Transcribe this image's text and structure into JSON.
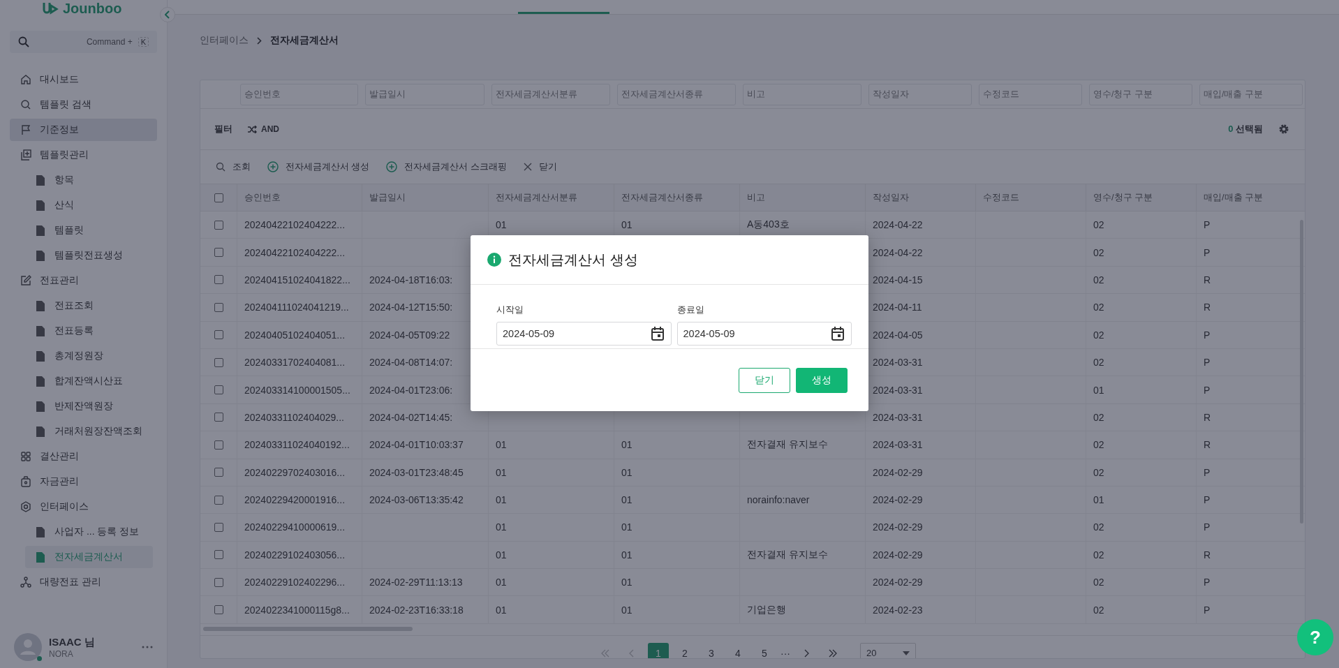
{
  "logo": "Jounboo",
  "sidebar": {
    "search": {
      "placeholder": "Command +",
      "shortcut": "K"
    },
    "items": [
      {
        "label": "대시보드",
        "highlighted": false,
        "selected": false
      },
      {
        "label": "템플릿 검색",
        "highlighted": false,
        "selected": false
      },
      {
        "label": "기준정보",
        "highlighted": true,
        "selected": false
      },
      {
        "label": "템플릿관리",
        "highlighted": false,
        "selected": false,
        "children": [
          {
            "label": "항목",
            "selected": false
          },
          {
            "label": "산식",
            "selected": false
          },
          {
            "label": "템플릿",
            "selected": false
          },
          {
            "label": "템플릿전표생성",
            "selected": false
          }
        ]
      },
      {
        "label": "전표관리",
        "highlighted": false,
        "selected": false,
        "children": [
          {
            "label": "전표조회",
            "selected": false
          },
          {
            "label": "전표등록",
            "selected": false
          },
          {
            "label": "총계정원장",
            "selected": false
          },
          {
            "label": "합계잔액시산표",
            "selected": false
          },
          {
            "label": "반제잔액원장",
            "selected": false
          },
          {
            "label": "거래처원장잔액조회",
            "selected": false
          }
        ]
      },
      {
        "label": "결산관리",
        "highlighted": false,
        "selected": false
      },
      {
        "label": "자금관리",
        "highlighted": false,
        "selected": false
      },
      {
        "label": "인터페이스",
        "highlighted": false,
        "selected": false,
        "children": [
          {
            "label": "사업자 ...   등록 정보",
            "selected": false
          },
          {
            "label": "전자세금계산서",
            "selected": true
          }
        ]
      },
      {
        "label": "대량전표 관리",
        "highlighted": false,
        "selected": false
      }
    ],
    "user": {
      "name": "ISAAC 님",
      "org": "NORA",
      "online": true
    }
  },
  "breadcrumb": [
    "인터페이스",
    "전자세금계산서"
  ],
  "filter_fields": [
    "승인번호",
    "발급일시",
    "전자세금계산서분류",
    "전자세금계산서종류",
    "비고",
    "작성일자",
    "수정코드",
    "영수/청구 구분",
    "매입/매출 구분"
  ],
  "filter_bar": {
    "label": "필터",
    "mode": "AND",
    "selected_count": "0",
    "selected_label": "선택됨"
  },
  "toolbar": [
    "조회",
    "전자세금계산서 생성",
    "전자세금계산서 스크래핑",
    "닫기"
  ],
  "table": {
    "all_checked": false,
    "columns": [
      "승인번호",
      "발급일시",
      "전자세금계산서분류",
      "전자세금계산서종류",
      "비고",
      "작성일자",
      "수정코드",
      "영수/청구 구분",
      "매입/매출 구분"
    ],
    "rows": [
      {
        "checked": false,
        "cells": [
          "20240422102404222...",
          null,
          "01",
          "01",
          "A동403호",
          "2024-04-22",
          null,
          "02",
          "P"
        ]
      },
      {
        "checked": false,
        "cells": [
          "20240422102404222...",
          null,
          null,
          null,
          null,
          "2024-04-22",
          null,
          "02",
          "P"
        ]
      },
      {
        "checked": false,
        "cells": [
          "202404151024041822...",
          "2024-04-18T16:03:",
          null,
          null,
          null,
          "2024-04-15",
          null,
          "02",
          "R"
        ]
      },
      {
        "checked": false,
        "cells": [
          "202404111024041219...",
          "2024-04-12T15:50:",
          null,
          null,
          null,
          "2024-04-11",
          null,
          "02",
          "R"
        ]
      },
      {
        "checked": false,
        "cells": [
          "20240405102404051...",
          "2024-04-05T09:22",
          null,
          null,
          null,
          "2024-04-05",
          null,
          "02",
          "P"
        ]
      },
      {
        "checked": false,
        "cells": [
          "20240331702404081...",
          "2024-04-08T14:07:",
          null,
          null,
          null,
          "2024-03-31",
          null,
          "02",
          "P"
        ]
      },
      {
        "checked": false,
        "cells": [
          "202403314100001505...",
          "2024-04-01T23:06:",
          null,
          null,
          null,
          "2024-03-31",
          null,
          "01",
          "P"
        ]
      },
      {
        "checked": false,
        "cells": [
          "20240331102404029...",
          "2024-04-02T14:45:",
          null,
          null,
          null,
          "2024-03-31",
          null,
          "02",
          "R"
        ]
      },
      {
        "checked": false,
        "cells": [
          "202403311024040192...",
          "2024-04-01T10:03:37",
          "01",
          "01",
          "전자결재 유지보수",
          "2024-03-31",
          null,
          "02",
          "R"
        ]
      },
      {
        "checked": false,
        "cells": [
          "20240229702403016...",
          "2024-03-01T23:48:45",
          "01",
          "01",
          null,
          "2024-02-29",
          null,
          "02",
          "P"
        ]
      },
      {
        "checked": false,
        "cells": [
          "20240229420001916...",
          "2024-03-06T13:35:42",
          "01",
          "01",
          "norainfo:naver",
          "2024-02-29",
          null,
          "01",
          "P"
        ]
      },
      {
        "checked": false,
        "cells": [
          "20240229410000619...",
          null,
          "01",
          "01",
          null,
          "2024-02-29",
          null,
          "02",
          "P"
        ]
      },
      {
        "checked": false,
        "cells": [
          "20240229102403056...",
          null,
          "01",
          "01",
          "전자결재 유지보수",
          "2024-02-29",
          null,
          "02",
          "R"
        ]
      },
      {
        "checked": false,
        "cells": [
          "20240229102402296...",
          "2024-02-29T11:13:13",
          "01",
          "01",
          null,
          "2024-02-29",
          null,
          "02",
          "P"
        ]
      },
      {
        "checked": false,
        "cells": [
          "2024022341000115g8...",
          "2024-02-23T16:33:18",
          "01",
          "01",
          "기업은행",
          "2024-02-23",
          null,
          "02",
          "P"
        ]
      }
    ]
  },
  "pagination": {
    "nav": [
      {
        "kind": "first",
        "disabled": true
      },
      {
        "kind": "prev",
        "disabled": true
      },
      {
        "kind": "next",
        "disabled": false
      },
      {
        "kind": "last",
        "disabled": false
      }
    ],
    "pages": [
      {
        "label": "1",
        "selected": true
      },
      {
        "label": "2",
        "selected": false
      },
      {
        "label": "3",
        "selected": false
      },
      {
        "label": "4",
        "selected": false
      },
      {
        "label": "5",
        "selected": false
      }
    ],
    "ellipsis": "···",
    "page_size": "20"
  },
  "dialog": {
    "title": "전자세금계산서 생성",
    "fields": [
      {
        "label": "시작일",
        "value": "2024-05-09"
      },
      {
        "label": "종료일",
        "value": "2024-05-09"
      }
    ],
    "buttons": [
      {
        "label": "닫기",
        "kind": "secondary"
      },
      {
        "label": "생성",
        "kind": "primary"
      }
    ]
  },
  "help_button": "?"
}
